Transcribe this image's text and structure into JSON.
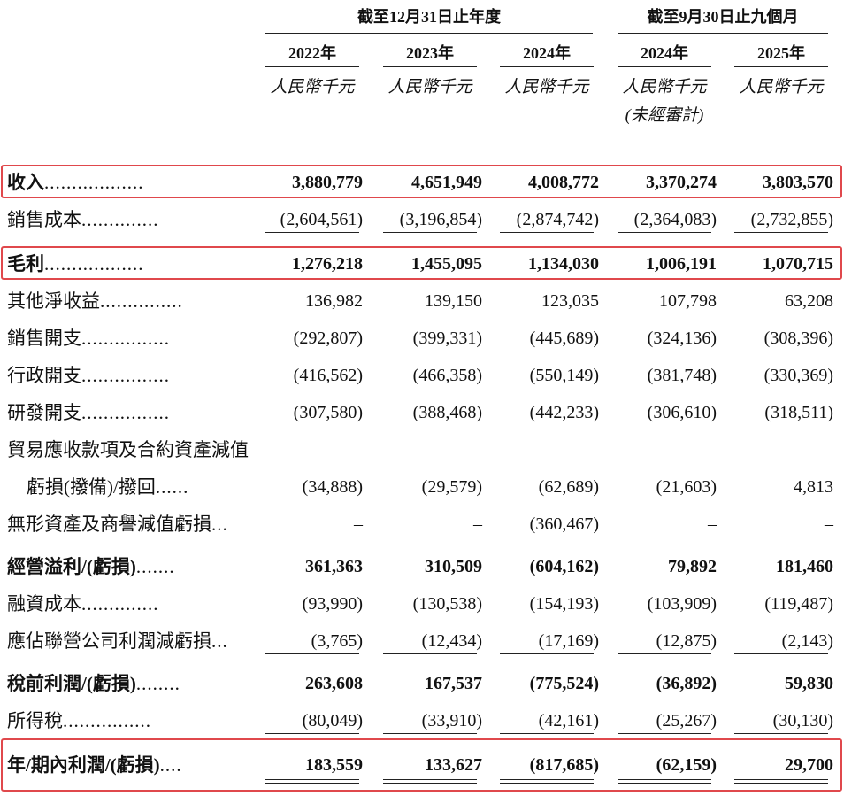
{
  "header": {
    "group_annual": "截至12月31日止年度",
    "group_nine_months": "截至9月30日止九個月",
    "columns": [
      {
        "year": "2022年",
        "unit": "人民幣千元",
        "note": ""
      },
      {
        "year": "2023年",
        "unit": "人民幣千元",
        "note": ""
      },
      {
        "year": "2024年",
        "unit": "人民幣千元",
        "note": ""
      },
      {
        "year": "2024年",
        "unit": "人民幣千元",
        "note": "(未經審計)"
      },
      {
        "year": "2025年",
        "unit": "人民幣千元",
        "note": ""
      }
    ]
  },
  "rows": [
    {
      "label": "收入",
      "dots": "..................",
      "bold": true,
      "highlight": true,
      "values": [
        "3,880,779",
        "4,651,949",
        "4,008,772",
        "3,370,274",
        "3,803,570"
      ]
    },
    {
      "label": "銷售成本",
      "dots": "..............",
      "bold": false,
      "values": [
        "(2,604,561)",
        "(3,196,854)",
        "(2,874,742)",
        "(2,364,083)",
        "(2,732,855)"
      ]
    },
    {
      "label": "毛利",
      "dots": "..................",
      "bold": true,
      "highlight": true,
      "values": [
        "1,276,218",
        "1,455,095",
        "1,134,030",
        "1,006,191",
        "1,070,715"
      ]
    },
    {
      "label": "其他淨收益",
      "dots": "...............",
      "bold": false,
      "values": [
        "136,982",
        "139,150",
        "123,035",
        "107,798",
        "63,208"
      ]
    },
    {
      "label": "銷售開支",
      "dots": "................",
      "bold": false,
      "values": [
        "(292,807)",
        "(399,331)",
        "(445,689)",
        "(324,136)",
        "(308,396)"
      ]
    },
    {
      "label": "行政開支",
      "dots": "................",
      "bold": false,
      "values": [
        "(416,562)",
        "(466,358)",
        "(550,149)",
        "(381,748)",
        "(330,369)"
      ]
    },
    {
      "label": "研發開支",
      "dots": "................",
      "bold": false,
      "values": [
        "(307,580)",
        "(388,468)",
        "(442,233)",
        "(306,610)",
        "(318,511)"
      ]
    },
    {
      "label": "貿易應收款項及合約資產減值",
      "dots": "",
      "bold": false,
      "values": [
        "",
        "",
        "",
        "",
        ""
      ]
    },
    {
      "label": "虧損(撥備)/撥回",
      "dots": "......",
      "bold": false,
      "indent": true,
      "values": [
        "(34,888)",
        "(29,579)",
        "(62,689)",
        "(21,603)",
        "4,813"
      ]
    },
    {
      "label": "無形資產及商譽減值虧損",
      "dots": "...",
      "bold": false,
      "values": [
        "–",
        "–",
        "(360,467)",
        "–",
        "–"
      ]
    },
    {
      "label": "經營溢利/(虧損)",
      "dots": ".......",
      "bold": true,
      "values": [
        "361,363",
        "310,509",
        "(604,162)",
        "79,892",
        "181,460"
      ]
    },
    {
      "label": "融資成本",
      "dots": "..............",
      "bold": false,
      "values": [
        "(93,990)",
        "(130,538)",
        "(154,193)",
        "(103,909)",
        "(119,487)"
      ]
    },
    {
      "label": "應佔聯營公司利潤減虧損",
      "dots": "...",
      "bold": false,
      "values": [
        "(3,765)",
        "(12,434)",
        "(17,169)",
        "(12,875)",
        "(2,143)"
      ]
    },
    {
      "label": "稅前利潤/(虧損)",
      "dots": "........",
      "bold": true,
      "values": [
        "263,608",
        "167,537",
        "(775,524)",
        "(36,892)",
        "59,830"
      ]
    },
    {
      "label": "所得稅",
      "dots": "................",
      "bold": false,
      "values": [
        "(80,049)",
        "(33,910)",
        "(42,161)",
        "(25,267)",
        "(30,130)"
      ]
    },
    {
      "label": "年/期內利潤/(虧損)",
      "dots": "....",
      "bold": true,
      "highlight": true,
      "values": [
        "183,559",
        "133,627",
        "(817,685)",
        "(62,159)",
        "29,700"
      ]
    }
  ]
}
